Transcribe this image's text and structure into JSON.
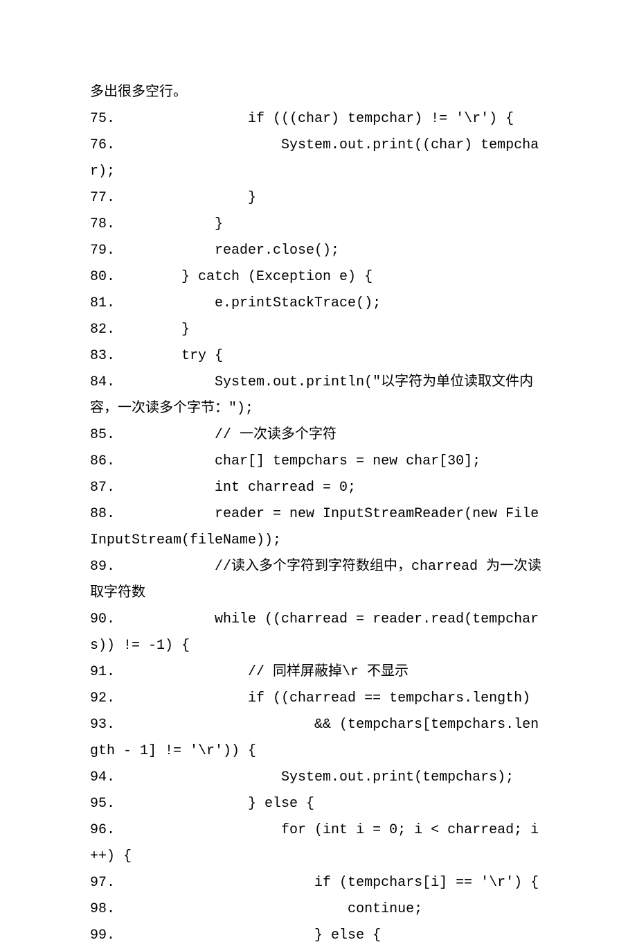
{
  "lines": [
    "多出很多空行。",
    "75.                if (((char) tempchar) != '\\r') {",
    "76.                    System.out.print((char) tempchar);",
    "77.                }",
    "78.            }",
    "79.            reader.close();",
    "80.        } catch (Exception e) {",
    "81.            e.printStackTrace();",
    "82.        }",
    "83.        try {",
    "84.            System.out.println(\"以字符为单位读取文件内容，一次读多个字节：\");",
    "85.            // 一次读多个字符",
    "86.            char[] tempchars = new char[30];",
    "87.            int charread = 0;",
    "88.            reader = new InputStreamReader(new FileInputStream(fileName));",
    "89.            //读入多个字符到字符数组中，charread 为一次读取字符数",
    "90.            while ((charread = reader.read(tempchars)) != -1) {",
    "91.                // 同样屏蔽掉\\r 不显示",
    "92.                if ((charread == tempchars.length)",
    "93.                        && (tempchars[tempchars.length - 1] != '\\r')) {",
    "94.                    System.out.print(tempchars);",
    "95.                } else {",
    "96.                    for (int i = 0; i < charread; i++) {",
    "97.                        if (tempchars[i] == '\\r') {",
    "98.                            continue;",
    "99.                        } else {"
  ]
}
